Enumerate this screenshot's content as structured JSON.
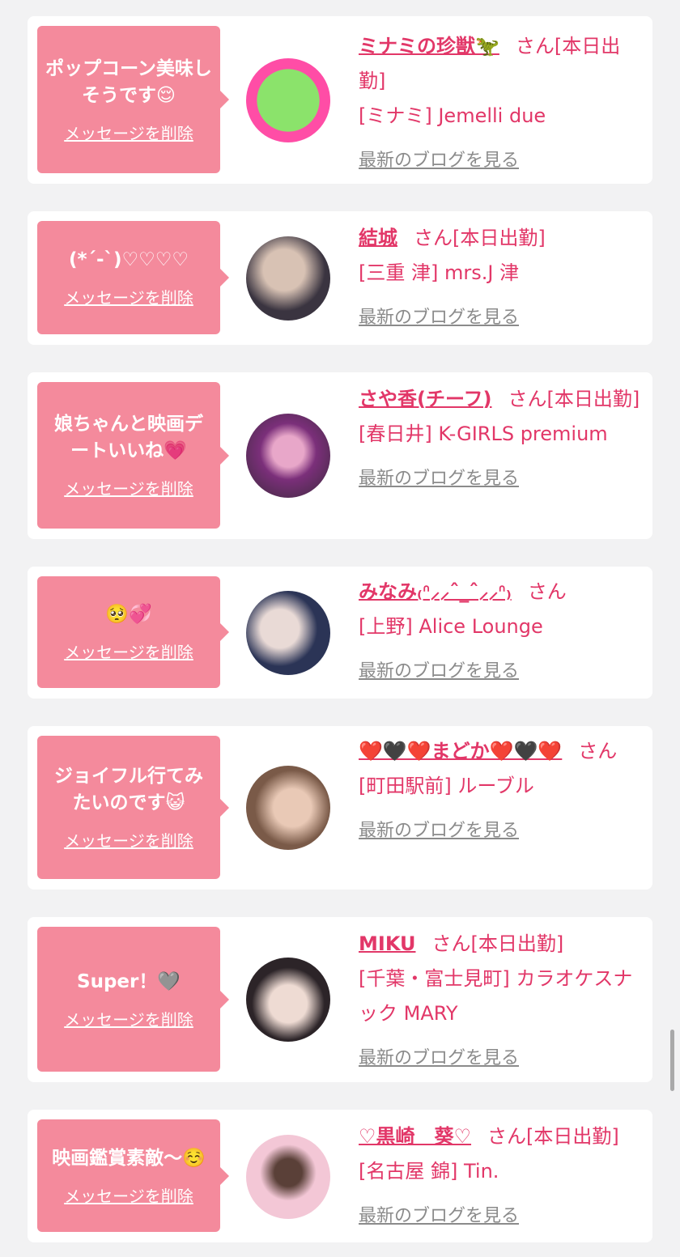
{
  "delete_label": "メッセージを削除",
  "blog_label": "最新のブログを見る",
  "cards": [
    {
      "message": "ポップコーン美味しそうです😌",
      "name": "ミナミの珍獣🦖",
      "suffix": "さん[本日出勤]",
      "shop": "[ミナミ] Jemelli due",
      "avatar_colors": [
        "#ff4da6",
        "#8be36b"
      ]
    },
    {
      "message": "(*´-`)♡♡♡♡",
      "name": "結城",
      "suffix": "さん[本日出勤]",
      "shop": "[三重 津] mrs.J 津",
      "avatar_colors": [
        "#3a3440",
        "#d8c2b4"
      ]
    },
    {
      "message": "娘ちゃんと映画デートいいね💗",
      "name": "さや香(チーフ)",
      "suffix": "さん[本日出勤]",
      "shop": "[春日井] K-GIRLS premium",
      "avatar_colors": [
        "#7b2f7a",
        "#e8a7c9"
      ]
    },
    {
      "message": "🥺💞",
      "name": "みなみ₍ᐢ⸝⸝ˆ_ˆ⸝⸝ᐢ₎",
      "suffix": "さん",
      "shop": "[上野] Alice Lounge",
      "avatar_colors": [
        "#2b3456",
        "#e9dad6"
      ]
    },
    {
      "message": "ジョイフル行てみたいのです😺",
      "name": "❤️🖤❤️まどか❤️🖤❤️",
      "suffix": "さん",
      "shop": "[町田駅前] ルーブル",
      "avatar_colors": [
        "#7a5a48",
        "#e9c9b6"
      ]
    },
    {
      "message": "Super！🩶",
      "name": "MIKU",
      "suffix": "さん[本日出勤]",
      "shop": "[千葉・富士見町] カラオケスナック MARY",
      "avatar_colors": [
        "#2c2428",
        "#eedbd3"
      ]
    },
    {
      "message": "映画鑑賞素敵〜☺️",
      "name": "♡黒崎　葵♡",
      "suffix": "さん[本日出勤]",
      "shop": "[名古屋 錦] Tin.",
      "avatar_colors": [
        "#f3c7d6",
        "#5a4038"
      ]
    }
  ]
}
